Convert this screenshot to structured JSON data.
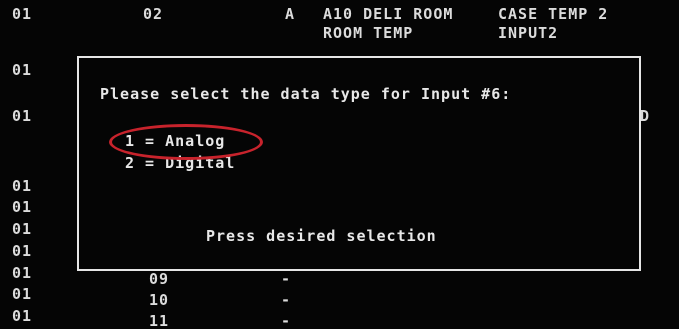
{
  "header_row": {
    "col1": "01",
    "col2": "02",
    "col3": "A",
    "col4_line1": "A10 DELI ROOM",
    "col4_line2": "ROOM TEMP",
    "col5_line1": "CASE TEMP 2",
    "col5_line2": "INPUT2"
  },
  "left_column": [
    "01",
    "01",
    "01",
    "01",
    "01",
    "01",
    "01",
    "01",
    "01",
    "01",
    "01"
  ],
  "partial_right_char": "D",
  "rows_below": [
    {
      "num": "09",
      "dash": "-"
    },
    {
      "num": "10",
      "dash": "-"
    },
    {
      "num": "11",
      "dash": "-"
    }
  ],
  "dialog": {
    "prompt": "Please select the data type for Input #6:",
    "option_1": "1 = Analog",
    "option_2": "2 = Digital",
    "footer": "Press desired selection"
  },
  "colors": {
    "background": "#050505",
    "text": "#dcdcdc",
    "border": "#e6e6e6",
    "highlight": "#c8232c"
  }
}
